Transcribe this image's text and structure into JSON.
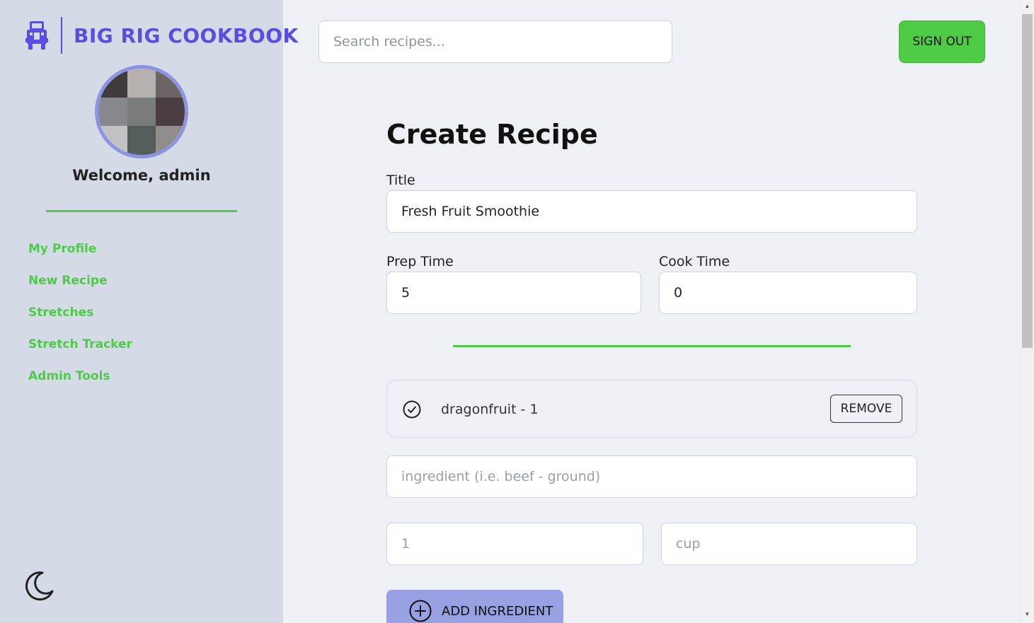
{
  "app": {
    "brand": "BIG RIG COOKBOOK"
  },
  "sidebar": {
    "welcome": "Welcome, admin",
    "avatar_colors": [
      "#3f3b3d",
      "#b6b0ae",
      "#6a6564",
      "#85898d",
      "#7a7c7c",
      "#4a3d42",
      "#c2c2c3",
      "#545d5b",
      "#8f8e8a"
    ],
    "nav": [
      {
        "label": "My Profile"
      },
      {
        "label": "New Recipe"
      },
      {
        "label": "Stretches"
      },
      {
        "label": "Stretch Tracker"
      },
      {
        "label": "Admin Tools"
      }
    ]
  },
  "header": {
    "search_placeholder": "Search recipes...",
    "sign_out": "SIGN OUT"
  },
  "form": {
    "heading": "Create Recipe",
    "title_label": "Title",
    "title_value": "Fresh Fruit Smoothie",
    "prep_label": "Prep Time",
    "prep_value": "5",
    "cook_label": "Cook Time",
    "cook_value": "0",
    "ingredients": [
      {
        "text": "dragonfruit - 1",
        "remove_label": "REMOVE"
      }
    ],
    "ingredient_placeholder": "ingredient (i.e. beef - ground)",
    "qty_placeholder": "1",
    "unit_placeholder": "cup",
    "add_ingredient": "ADD INGREDIENT"
  },
  "colors": {
    "brand": "#5a4de0",
    "accent_green": "#4fc94a",
    "add_button": "#97a1e2",
    "sidebar_bg": "#d4dbe7",
    "page_bg": "#edf0f5"
  },
  "icons": [
    "truck-icon",
    "moon-icon",
    "check-circle-icon",
    "plus-circle-icon"
  ]
}
